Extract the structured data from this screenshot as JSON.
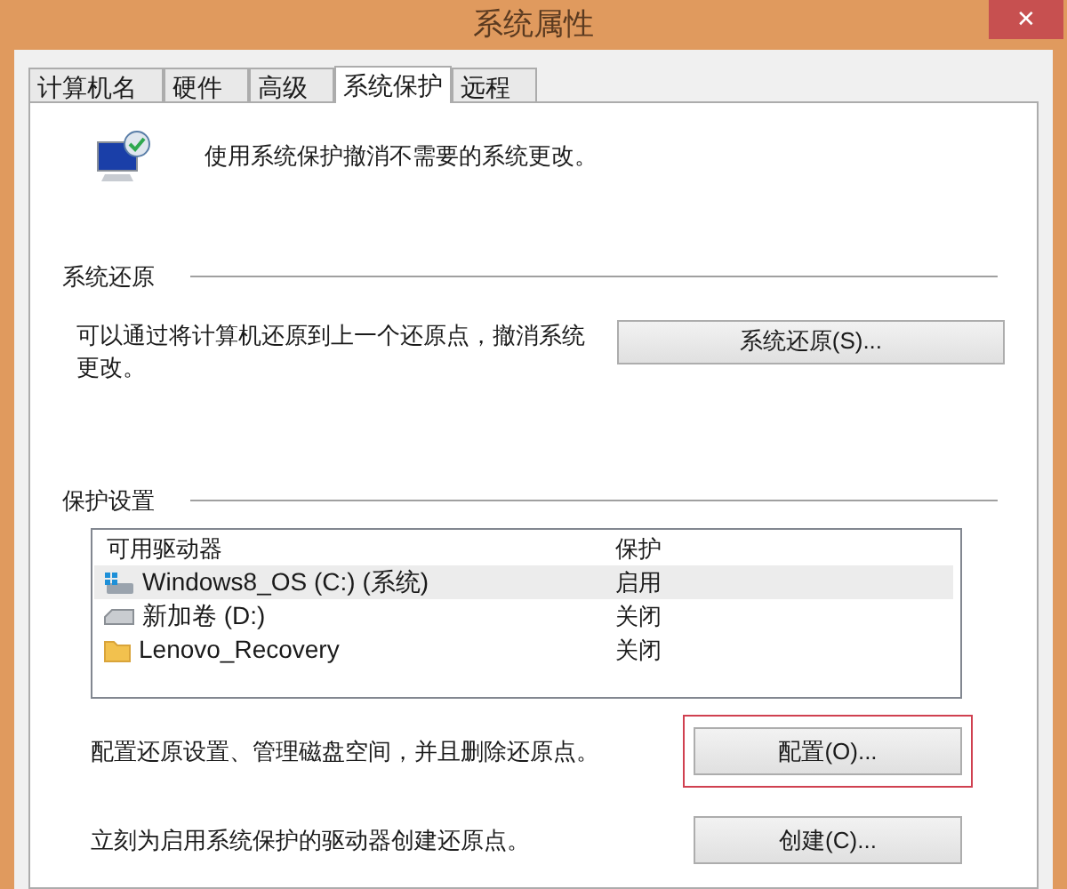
{
  "window": {
    "title": "系统属性",
    "close": "✕"
  },
  "tabs": [
    {
      "label": "计算机名",
      "selected": false
    },
    {
      "label": "硬件",
      "selected": false
    },
    {
      "label": "高级",
      "selected": false
    },
    {
      "label": "系统保护",
      "selected": true
    },
    {
      "label": "远程",
      "selected": false
    }
  ],
  "intro": "使用系统保护撤消不需要的系统更改。",
  "restore": {
    "heading": "系统还原",
    "description": "可以通过将计算机还原到上一个还原点，撤消系统更改。",
    "button": "系统还原(S)..."
  },
  "protection": {
    "heading": "保护设置",
    "columns": [
      "可用驱动器",
      "保护"
    ],
    "rows": [
      {
        "kind": "system-drive",
        "name": "Windows8_OS (C:) (系统)",
        "status": "启用",
        "selected": true
      },
      {
        "kind": "drive",
        "name": "新加卷 (D:)",
        "status": "关闭",
        "selected": false
      },
      {
        "kind": "folder",
        "name": "Lenovo_Recovery",
        "status": "关闭",
        "selected": false
      }
    ],
    "actions": [
      {
        "description": "配置还原设置、管理磁盘空间，并且删除还原点。",
        "button": "配置(O)...",
        "highlighted": true
      },
      {
        "description": "立刻为启用系统保护的驱动器创建还原点。",
        "button": "创建(C)...",
        "highlighted": false
      }
    ]
  }
}
